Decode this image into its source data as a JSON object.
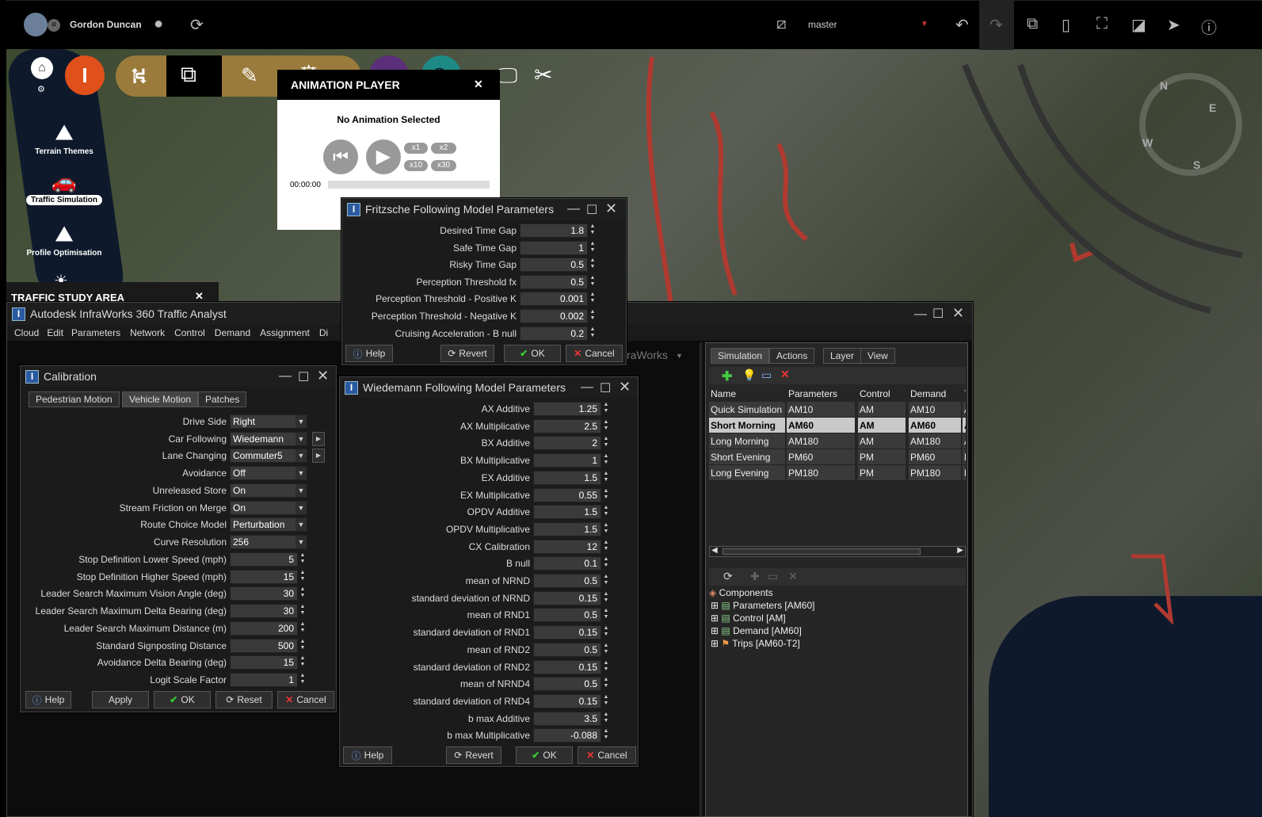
{
  "topbar": {
    "user_name": "Gordon Duncan",
    "branch": "master"
  },
  "nav": {
    "terrain_label": "Terrain Themes",
    "traffic_label": "Traffic Simulation",
    "profile_label": "Profile Optimisation"
  },
  "animation_player": {
    "title": "ANIMATION PLAYER",
    "status": "No Animation Selected",
    "speeds": [
      "x1",
      "x2",
      "x10",
      "x30"
    ],
    "time": "00:00:00"
  },
  "study_area": {
    "title": "TRAFFIC STUDY AREA"
  },
  "main_window": {
    "title": "Autodesk InfraWorks 360 Traffic Analyst",
    "menu": [
      "Cloud",
      "Edit",
      "Parameters",
      "Network",
      "Control",
      "Demand",
      "Assignment",
      "Di"
    ],
    "bg_text": "raWorks"
  },
  "fritzsche": {
    "title": "Fritzsche Following Model Parameters",
    "params": [
      {
        "label": "Desired Time Gap",
        "value": "1.8"
      },
      {
        "label": "Safe Time Gap",
        "value": "1"
      },
      {
        "label": "Risky Time Gap",
        "value": "0.5"
      },
      {
        "label": "Perception Threshold fx",
        "value": "0.5"
      },
      {
        "label": "Perception Threshold - Positive K",
        "value": "0.001"
      },
      {
        "label": "Perception Threshold - Negative K",
        "value": "0.002"
      },
      {
        "label": "Cruising Acceleration - B null",
        "value": "0.2"
      }
    ],
    "buttons": {
      "help": "Help",
      "revert": "Revert",
      "ok": "OK",
      "cancel": "Cancel"
    }
  },
  "calibration": {
    "title": "Calibration",
    "tabs": [
      "Pedestrian Motion",
      "Vehicle Motion",
      "Patches"
    ],
    "selects": [
      {
        "label": "Drive Side",
        "value": "Right"
      },
      {
        "label": "Car Following",
        "value": "Wiedemann"
      },
      {
        "label": "Lane Changing",
        "value": "Commuter5"
      },
      {
        "label": "Avoidance",
        "value": "Off"
      },
      {
        "label": "Unreleased Store",
        "value": "On"
      },
      {
        "label": "Stream Friction on Merge",
        "value": "On"
      },
      {
        "label": "Route Choice Model",
        "value": "Perturbation"
      },
      {
        "label": "Curve Resolution",
        "value": "256"
      }
    ],
    "nums": [
      {
        "label": "Stop Definition Lower Speed (mph)",
        "value": "5"
      },
      {
        "label": "Stop Definition Higher Speed (mph)",
        "value": "15"
      },
      {
        "label": "Leader Search Maximum Vision Angle (deg)",
        "value": "30"
      },
      {
        "label": "Leader Search Maximum Delta Bearing (deg)",
        "value": "30"
      },
      {
        "label": "Leader Search Maximum Distance (m)",
        "value": "200"
      },
      {
        "label": "Standard Signposting Distance",
        "value": "500"
      },
      {
        "label": "Avoidance Delta Bearing (deg)",
        "value": "15"
      },
      {
        "label": "Logit Scale Factor",
        "value": "1"
      }
    ],
    "buttons": {
      "help": "Help",
      "apply": "Apply",
      "ok": "OK",
      "reset": "Reset",
      "cancel": "Cancel"
    }
  },
  "wiedemann": {
    "title": "Wiedemann Following Model Parameters",
    "params": [
      {
        "label": "AX Additive",
        "value": "1.25"
      },
      {
        "label": "AX Multiplicative",
        "value": "2.5"
      },
      {
        "label": "BX Additive",
        "value": "2"
      },
      {
        "label": "BX Multiplicative",
        "value": "1"
      },
      {
        "label": "EX Additive",
        "value": "1.5"
      },
      {
        "label": "EX Multiplicative",
        "value": "0.55"
      },
      {
        "label": "OPDV Additive",
        "value": "1.5"
      },
      {
        "label": "OPDV Multiplicative",
        "value": "1.5"
      },
      {
        "label": "CX Calibration",
        "value": "12"
      },
      {
        "label": "B null",
        "value": "0.1"
      },
      {
        "label": "mean of NRND",
        "value": "0.5"
      },
      {
        "label": "standard deviation of NRND",
        "value": "0.15"
      },
      {
        "label": "mean of RND1",
        "value": "0.5"
      },
      {
        "label": "standard deviation of RND1",
        "value": "0.15"
      },
      {
        "label": "mean of RND2",
        "value": "0.5"
      },
      {
        "label": "standard deviation of RND2",
        "value": "0.15"
      },
      {
        "label": "mean of NRND4",
        "value": "0.5"
      },
      {
        "label": "standard deviation of RND4",
        "value": "0.15"
      },
      {
        "label": "b max Additive",
        "value": "3.5"
      },
      {
        "label": "b max Multiplicative",
        "value": "-0.088"
      }
    ],
    "buttons": {
      "help": "Help",
      "revert": "Revert",
      "ok": "OK",
      "cancel": "Cancel"
    }
  },
  "simulation_panel": {
    "tabs": [
      "Simulation",
      "Actions",
      "Layer",
      "View"
    ],
    "columns": [
      "Name",
      "Parameters",
      "Control",
      "Demand",
      "T"
    ],
    "rows": [
      {
        "name": "Quick Simulation",
        "parameters": "AM10",
        "control": "AM",
        "demand": "AM10",
        "t": "A"
      },
      {
        "name": "Short Morning",
        "parameters": "AM60",
        "control": "AM",
        "demand": "AM60",
        "t": "A"
      },
      {
        "name": "Long Morning",
        "parameters": "AM180",
        "control": "AM",
        "demand": "AM180",
        "t": "A"
      },
      {
        "name": "Short Evening",
        "parameters": "PM60",
        "control": "PM",
        "demand": "PM60",
        "t": "F"
      },
      {
        "name": "Long Evening",
        "parameters": "PM180",
        "control": "PM",
        "demand": "PM180",
        "t": "F"
      }
    ],
    "tree_root": "Components",
    "tree_items": [
      "Parameters [AM60]",
      "Control [AM]",
      "Demand [AM60]",
      "Trips [AM60-T2]"
    ]
  },
  "compass": {
    "n": "N",
    "e": "E",
    "s": "S",
    "w": "W"
  }
}
